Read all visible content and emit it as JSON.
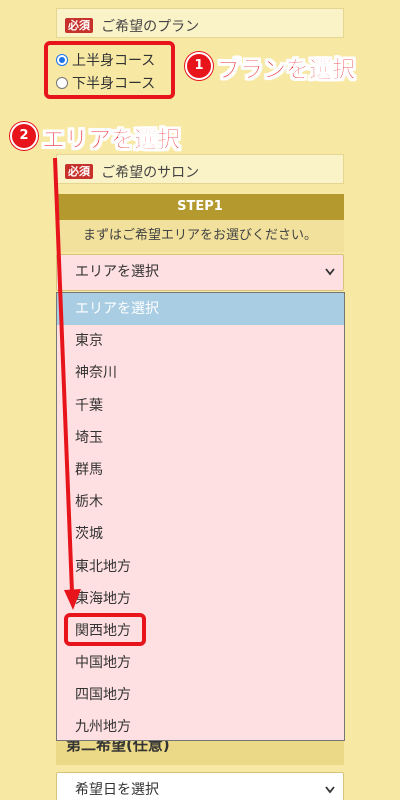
{
  "plan": {
    "required_badge": "必須",
    "title": "ご希望のプラン",
    "options": [
      {
        "label": "上半身コース",
        "checked": true
      },
      {
        "label": "下半身コース",
        "checked": false
      }
    ]
  },
  "annotations": {
    "step1_num": "1",
    "step1_label": "プランを選択",
    "step2_num": "2",
    "step2_label": "エリアを選択",
    "color": "#e8141c"
  },
  "salon": {
    "required_badge": "必須",
    "title": "ご希望のサロン",
    "step_title": "STEP1",
    "step_desc": "まずはご希望エリアをお選びください。",
    "area_select_value": "エリアを選択",
    "area_options": [
      "エリアを選択",
      "東京",
      "神奈川",
      "千葉",
      "埼玉",
      "群馬",
      "栃木",
      "茨城",
      "東北地方",
      "東海地方",
      "関西地方",
      "中国地方",
      "四国地方",
      "九州地方"
    ],
    "highlighted_option": "関西地方"
  },
  "second_choice": {
    "partial_label": "第二希望(任意)",
    "date_select_value": "希望日を選択"
  }
}
